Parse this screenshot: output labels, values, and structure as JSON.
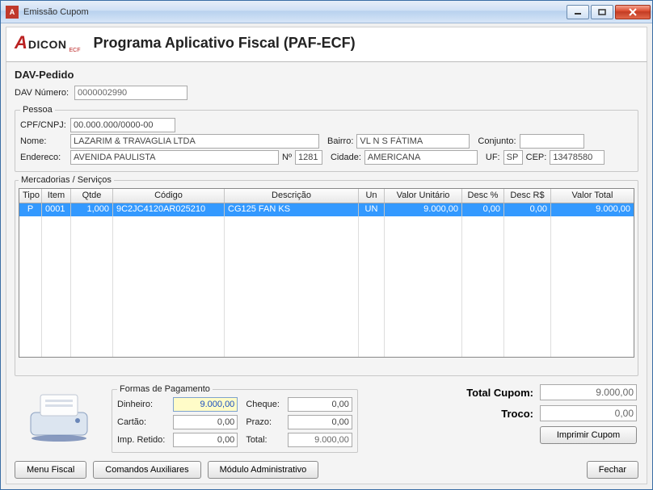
{
  "window": {
    "title": "Emissão Cupom"
  },
  "banner": {
    "app_title": "Programa Aplicativo Fiscal (PAF-ECF)"
  },
  "dav": {
    "section": "DAV-Pedido",
    "num_label": "DAV Número:",
    "num_value": "0000002990"
  },
  "pessoa": {
    "legend": "Pessoa",
    "cpf_label": "CPF/CNPJ:",
    "cpf_value": "00.000.000/0000-00",
    "nome_label": "Nome:",
    "nome_value": "LAZARIM & TRAVAGLIA LTDA",
    "bairro_label": "Bairro:",
    "bairro_value": "VL N S FÁTIMA",
    "conjunto_label": "Conjunto:",
    "conjunto_value": "",
    "endereco_label": "Endereco:",
    "endereco_value": "AVENIDA PAULISTA",
    "num_label": "Nº",
    "num_value": "1281",
    "cidade_label": "Cidade:",
    "cidade_value": "AMERICANA",
    "uf_label": "UF:",
    "uf_value": "SP",
    "cep_label": "CEP:",
    "cep_value": "13478580"
  },
  "grid": {
    "legend": "Mercadorias / Serviços",
    "headers": {
      "tipo": "Tipo",
      "item": "Item",
      "qtde": "Qtde",
      "codigo": "Código",
      "descricao": "Descrição",
      "un": "Un",
      "vunit": "Valor Unitário",
      "descp": "Desc %",
      "descr": "Desc R$",
      "vtot": "Valor Total"
    },
    "rows": [
      {
        "tipo": "P",
        "item": "0001",
        "qtde": "1,000",
        "codigo": "9C2JC4120AR025210",
        "descricao": "CG125 FAN KS",
        "un": "UN",
        "vunit": "9.000,00",
        "descp": "0,00",
        "descr": "0,00",
        "vtot": "9.000,00"
      }
    ]
  },
  "pagamento": {
    "legend": "Formas de Pagamento",
    "dinheiro_label": "Dinheiro:",
    "dinheiro_value": "9.000,00",
    "cartao_label": "Cartão:",
    "cartao_value": "0,00",
    "impretido_label": "Imp. Retido:",
    "impretido_value": "0,00",
    "cheque_label": "Cheque:",
    "cheque_value": "0,00",
    "prazo_label": "Prazo:",
    "prazo_value": "0,00",
    "total_label": "Total:",
    "total_value": "9.000,00"
  },
  "totais": {
    "total_cupom_label": "Total Cupom:",
    "total_cupom_value": "9.000,00",
    "troco_label": "Troco:",
    "troco_value": "0,00",
    "imprimir_label": "Imprimir Cupom"
  },
  "footer": {
    "menu_fiscal": "Menu Fiscal",
    "comandos": "Comandos Auxiliares",
    "modulo": "Módulo Administrativo",
    "fechar": "Fechar"
  }
}
